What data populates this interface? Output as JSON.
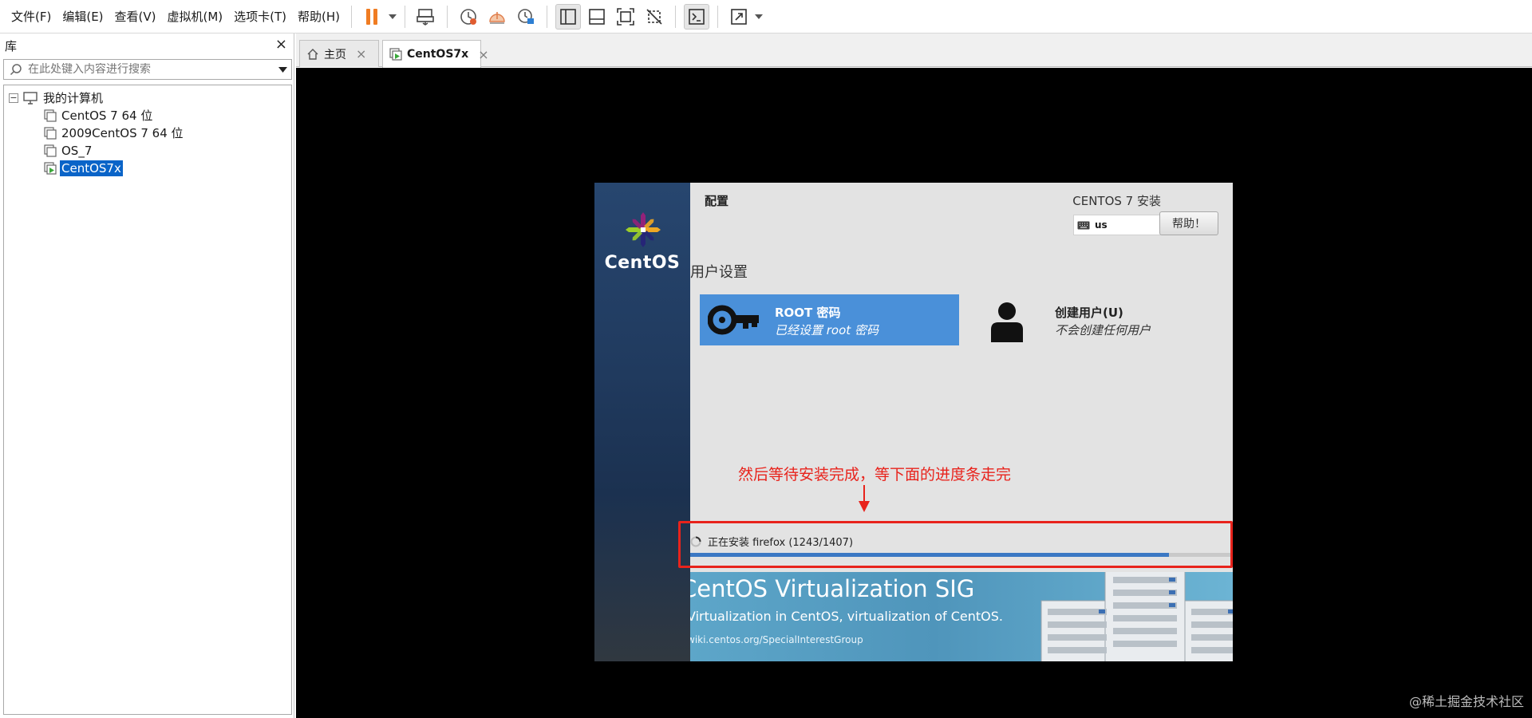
{
  "menu": [
    "文件(F)",
    "编辑(E)",
    "查看(V)",
    "虚拟机(M)",
    "选项卡(T)",
    "帮助(H)"
  ],
  "toolbar": {
    "icons": [
      "pause-icon",
      "send-keys-icon",
      "snapshot-icon",
      "revert-snapshot-icon",
      "snapshot-manager-icon",
      "library-view-icon",
      "thumbnail-view-icon",
      "fullscreen-icon",
      "unity-icon",
      "console-icon",
      "stretch-icon"
    ]
  },
  "library": {
    "title": "库",
    "search_placeholder": "在此处键入内容进行搜索",
    "root": "我的计算机",
    "vms": [
      "CentOS 7 64 位",
      "2009CentOS 7 64 位",
      "OS_7",
      "CentOS7x"
    ],
    "selected": "CentOS7x"
  },
  "tabs": [
    {
      "label": "主页",
      "active": false
    },
    {
      "label": "CentOS7x",
      "active": true
    }
  ],
  "guest": {
    "brand": "CentOS",
    "config_title": "配置",
    "install_title": "CENTOS 7 安装",
    "keyboard_layout": "us",
    "help_button": "帮助！",
    "section_title": "用户设置",
    "root_title": "ROOT 密码",
    "root_status": "已经设置 root 密码",
    "user_title": "创建用户(U)",
    "user_status": "不会创建任何用户",
    "progress_text": "正在安装 firefox (1243/1407)",
    "progress_fraction": 0.8834,
    "banner_title": "CentOS Virtualization SIG",
    "banner_subtitle": "Virtualization in CentOS, virtualization of CentOS.",
    "banner_url": "wiki.centos.org/SpecialInterestGroup"
  },
  "annotation": {
    "text": "然后等待安装完成，等下面的进度条走完",
    "color": "#e8231c"
  },
  "watermark": "@稀土掘金技术社区",
  "colors": {
    "accent": "#0a64c8",
    "root_card": "#4a90d9",
    "progress": "#3b78c4"
  }
}
